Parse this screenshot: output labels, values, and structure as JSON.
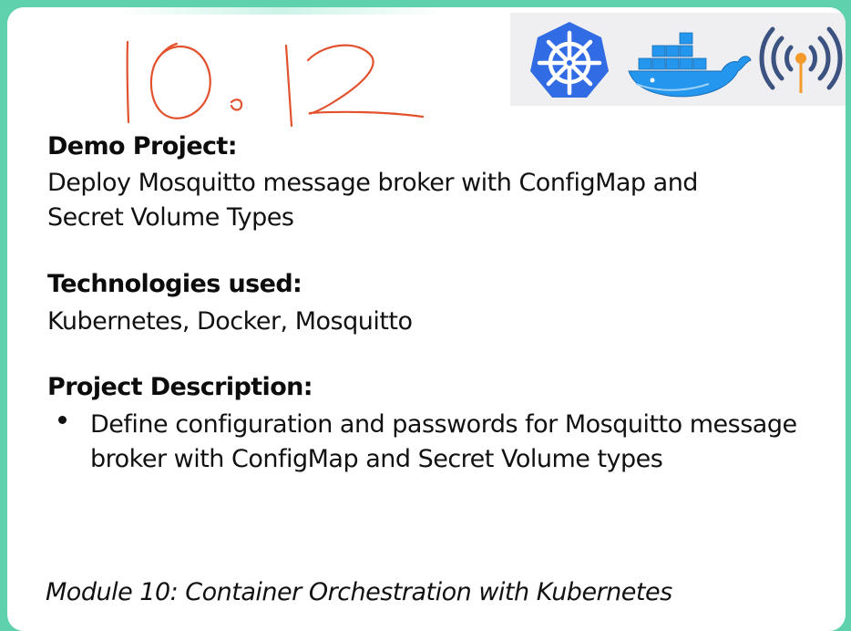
{
  "handwritten_label": "10.12",
  "logos": [
    "kubernetes-logo",
    "docker-logo",
    "mosquitto-logo"
  ],
  "colors": {
    "background": "#5fd2ad",
    "handwriting": "#e2522f",
    "kubernetes": "#326ce5",
    "docker": "#2496ed",
    "mosquitto_blue": "#3c5280",
    "mosquitto_orange": "#f39a2b"
  },
  "demo_project": {
    "heading": "Demo Project:",
    "lines": [
      "Deploy Mosquitto message broker with ConfigMap and",
      "Secret Volume Types"
    ]
  },
  "technologies": {
    "heading": "Technologies used:",
    "text": "Kubernetes, Docker, Mosquitto"
  },
  "project_description": {
    "heading": "Project Description:",
    "bullets": [
      "Define configuration and passwords for Mosquitto message broker with ConfigMap and Secret Volume types"
    ]
  },
  "footer": "Module 10: Container Orchestration with Kubernetes"
}
